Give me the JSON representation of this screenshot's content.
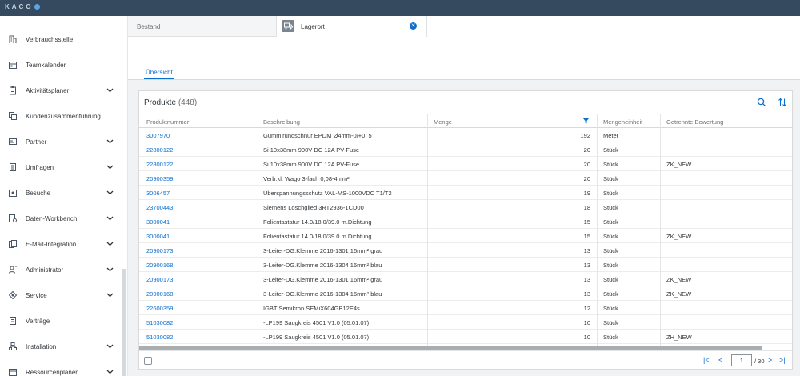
{
  "app": {
    "logo_text": "KACO"
  },
  "sidebar": {
    "items": [
      {
        "label": "Verbrauchsstelle",
        "icon": "building-icon",
        "expandable": false
      },
      {
        "label": "Teamkalender",
        "icon": "calendar-icon",
        "expandable": false
      },
      {
        "label": "Aktivitätsplaner",
        "icon": "clipboard-icon",
        "expandable": true
      },
      {
        "label": "Kundenzusammenführung",
        "icon": "merge-icon",
        "expandable": false
      },
      {
        "label": "Partner",
        "icon": "card-icon",
        "expandable": true
      },
      {
        "label": "Umfragen",
        "icon": "survey-icon",
        "expandable": true
      },
      {
        "label": "Besuche",
        "icon": "visit-icon",
        "expandable": true
      },
      {
        "label": "Daten-Workbench",
        "icon": "data-icon",
        "expandable": true
      },
      {
        "label": "E-Mail-Integration",
        "icon": "email-icon",
        "expandable": true
      },
      {
        "label": "Administrator",
        "icon": "admin-icon",
        "expandable": true
      },
      {
        "label": "Service",
        "icon": "service-icon",
        "expandable": true
      },
      {
        "label": "Verträge",
        "icon": "contract-icon",
        "expandable": false
      },
      {
        "label": "Installation",
        "icon": "installation-icon",
        "expandable": true
      },
      {
        "label": "Ressourcenplaner",
        "icon": "resource-icon",
        "expandable": true
      }
    ]
  },
  "tabs": {
    "inactive_label": "Bestand",
    "active_label": "Lagerort",
    "close_glyph": "✕"
  },
  "subtabs": {
    "overview": "Übersicht"
  },
  "table": {
    "title": "Produkte",
    "count": "(448)",
    "columns": {
      "produktnummer": "Produktnummer",
      "beschreibung": "Beschreibung",
      "menge": "Menge",
      "mengeneinheit": "Mengeneinheit",
      "bewertung": "Getrennte Bewertung"
    },
    "rows": [
      {
        "nr": "3007970",
        "desc": "Gummirundschnur EPDM Ø4mm-0/+0, 5",
        "qty": "192",
        "unit": "Meter",
        "val": ""
      },
      {
        "nr": "22800122",
        "desc": "Si 10x38mm 900V DC 12A PV-Fuse",
        "qty": "20",
        "unit": "Stück",
        "val": ""
      },
      {
        "nr": "22800122",
        "desc": "Si 10x38mm 900V DC 12A PV-Fuse",
        "qty": "20",
        "unit": "Stück",
        "val": "ZK_NEW"
      },
      {
        "nr": "20900359",
        "desc": "Verb.kl. Wago 3-fach 0,08-4mm²",
        "qty": "20",
        "unit": "Stück",
        "val": ""
      },
      {
        "nr": "3006457",
        "desc": "Überspannungsschutz VAL-MS-1000VDC T1/T2",
        "qty": "19",
        "unit": "Stück",
        "val": ""
      },
      {
        "nr": "23700443",
        "desc": "Siemens Löschglied 3RT2936-1CD00",
        "qty": "18",
        "unit": "Stück",
        "val": ""
      },
      {
        "nr": "3000041",
        "desc": "Folientastatur 14.0/18.0/39.0 m.Dichtung",
        "qty": "15",
        "unit": "Stück",
        "val": ""
      },
      {
        "nr": "3000041",
        "desc": "Folientastatur 14.0/18.0/39.0 m.Dichtung",
        "qty": "15",
        "unit": "Stück",
        "val": "ZK_NEW"
      },
      {
        "nr": "20900173",
        "desc": "3-Leiter-DG.Klemme 2016-1301 16mm² grau",
        "qty": "13",
        "unit": "Stück",
        "val": ""
      },
      {
        "nr": "20900168",
        "desc": "3-Leiter-DG.Klemme 2016-1304 16mm² blau",
        "qty": "13",
        "unit": "Stück",
        "val": ""
      },
      {
        "nr": "20900173",
        "desc": "3-Leiter-DG.Klemme 2016-1301 16mm² grau",
        "qty": "13",
        "unit": "Stück",
        "val": "ZK_NEW"
      },
      {
        "nr": "20900168",
        "desc": "3-Leiter-DG.Klemme 2016-1304 16mm² blau",
        "qty": "13",
        "unit": "Stück",
        "val": "ZK_NEW"
      },
      {
        "nr": "22600359",
        "desc": "IGBT Semikron SEMiX604GB12E4s",
        "qty": "12",
        "unit": "Stück",
        "val": ""
      },
      {
        "nr": "51030082",
        "desc": "-LP199 Saugkreis 4501 V1.0 (05.01.07)",
        "qty": "10",
        "unit": "Stück",
        "val": ""
      },
      {
        "nr": "51030082",
        "desc": "-LP199 Saugkreis 4501 V1.0 (05.01.07)",
        "qty": "10",
        "unit": "Stück",
        "val": "ZH_NEW"
      }
    ]
  },
  "pagination": {
    "current": "1",
    "total": "/ 30",
    "first": "|<",
    "prev": "<",
    "next": ">",
    "last": ">|"
  },
  "colors": {
    "accent": "#0a6ed1",
    "shell": "#354a5f"
  }
}
